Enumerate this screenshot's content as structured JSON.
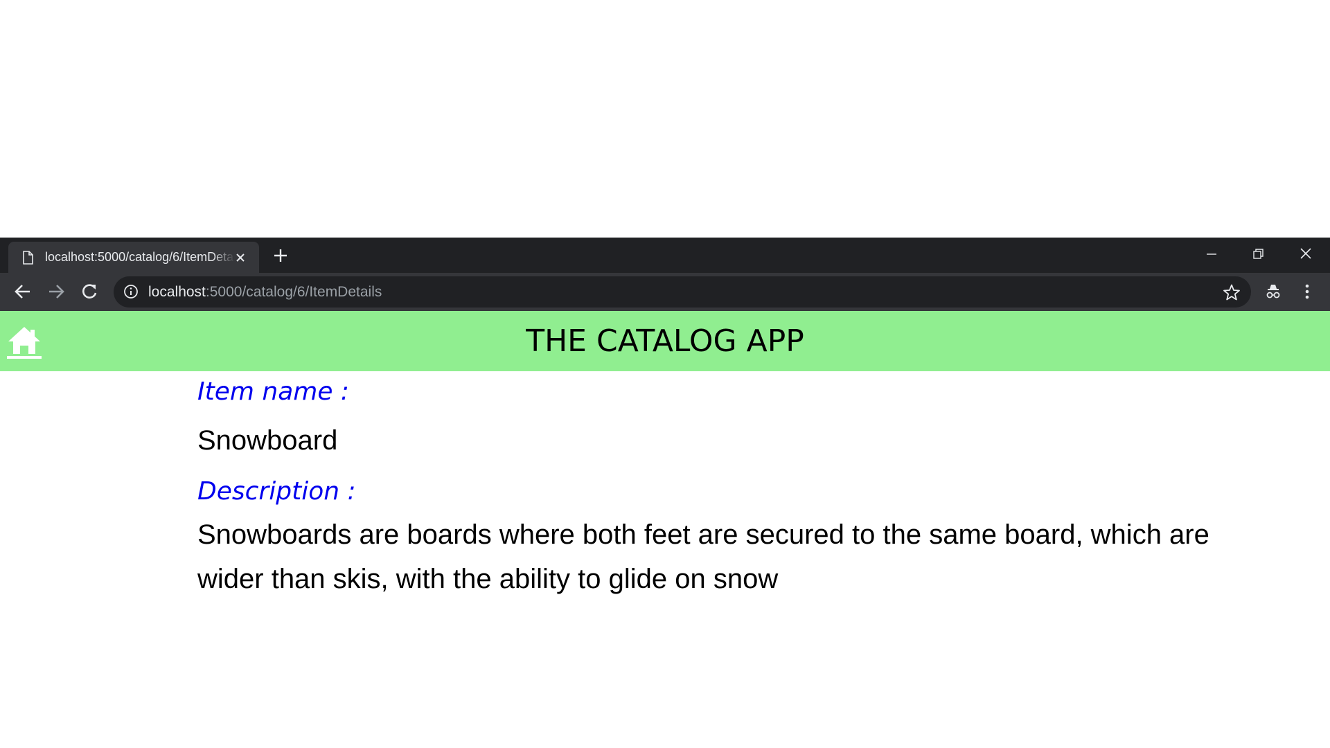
{
  "browser": {
    "tab": {
      "title": "localhost:5000/catalog/6/ItemDetails",
      "icon": "page-icon"
    },
    "address": {
      "host": "localhost",
      "path": ":5000/catalog/6/ItemDetails"
    },
    "colors": {
      "tabstrip": "#202124",
      "toolbar": "#35363a",
      "omnibox": "#202124"
    }
  },
  "header": {
    "title": "THE CATALOG APP",
    "home_icon": "home-icon",
    "background": "#90ee90"
  },
  "item": {
    "name_label": "Item name :",
    "name": "Snowboard",
    "description_label": "Description :",
    "description": "Snowboards are boards where both feet are secured to the same board, which are wider than skis, with the ability to glide on snow",
    "label_color": "#0000ee"
  }
}
